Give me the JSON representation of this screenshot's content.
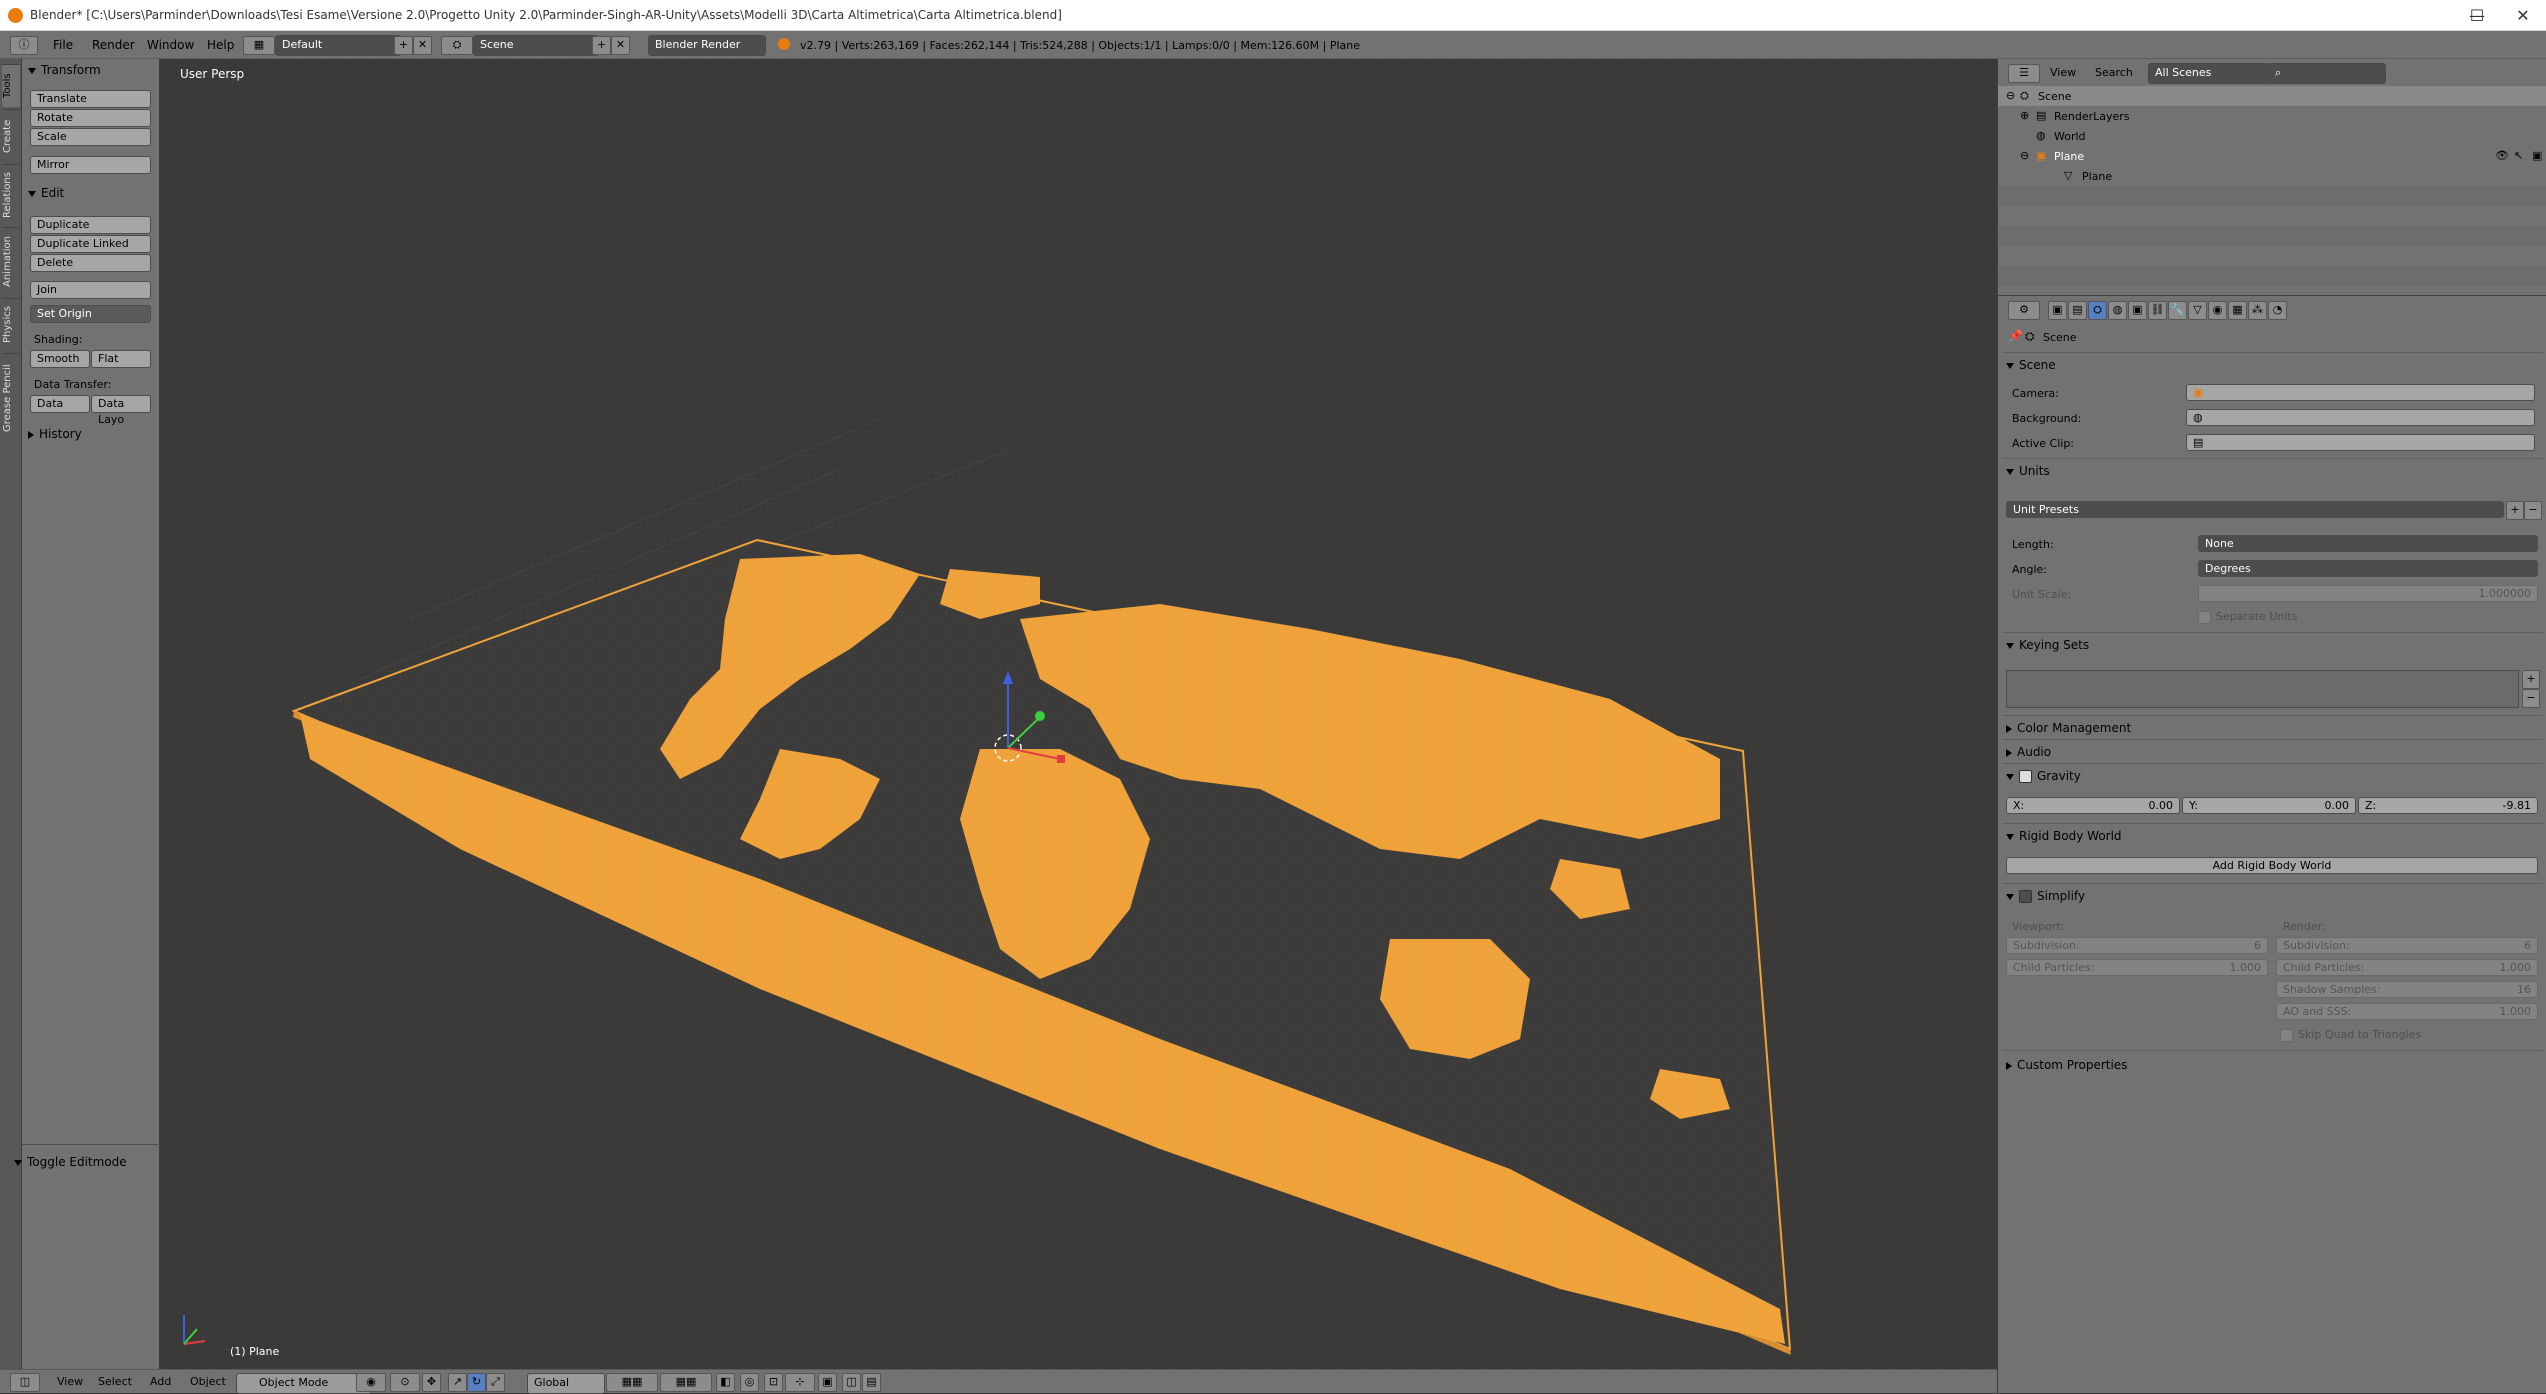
{
  "titlebar": {
    "title": "Blender* [C:\\Users\\Parminder\\Downloads\\Tesi Esame\\Versione 2.0\\Progetto Unity 2.0\\Parminder-Singh-AR-Unity\\Assets\\Modelli 3D\\Carta Altimetrica\\Carta Altimetrica.blend]",
    "minimize": "—",
    "maximize": "☐",
    "close": "✕"
  },
  "info_header": {
    "menus": [
      "File",
      "Render",
      "Window",
      "Help"
    ],
    "layout": "Default",
    "scene": "Scene",
    "engine": "Blender Render",
    "stats": "v2.79 | Verts:263,169 | Faces:262,144 | Tris:524,288 | Objects:1/1 | Lamps:0/0 | Mem:126.60M | Plane"
  },
  "tool_tabs": [
    "Tools",
    "Create",
    "Relations",
    "Animation",
    "Physics",
    "Grease Pencil"
  ],
  "tool_shelf": {
    "transform_title": "Transform",
    "translate": "Translate",
    "rotate": "Rotate",
    "scale": "Scale",
    "mirror": "Mirror",
    "edit_title": "Edit",
    "duplicate": "Duplicate",
    "duplicate_linked": "Duplicate Linked",
    "delete": "Delete",
    "join": "Join",
    "set_origin": "Set Origin",
    "shading_label": "Shading:",
    "smooth": "Smooth",
    "flat": "Flat",
    "data_transfer_label": "Data Transfer:",
    "data": "Data",
    "data_layout": "Data Layo",
    "history_title": "History",
    "toggle_editmode": "Toggle Editmode"
  },
  "viewport": {
    "view_label": "User Persp",
    "object_label": "(1) Plane",
    "mesh_color": "#f0a33b"
  },
  "bottom_header": {
    "menus": [
      "View",
      "Select",
      "Add",
      "Object"
    ],
    "mode": "Object Mode",
    "orientation": "Global"
  },
  "outliner": {
    "view": "View",
    "search": "Search",
    "scenes": "All Scenes",
    "items": [
      "Scene",
      "RenderLayers",
      "World",
      "Plane",
      "Plane"
    ]
  },
  "properties": {
    "context": "Scene",
    "scene_title": "Scene",
    "camera_label": "Camera:",
    "background_label": "Background:",
    "active_clip_label": "Active Clip:",
    "units_title": "Units",
    "unit_presets": "Unit Presets",
    "length_label": "Length:",
    "length_value": "None",
    "angle_label": "Angle:",
    "angle_value": "Degrees",
    "unit_scale_label": "Unit Scale:",
    "unit_scale_value": "1.000000",
    "separate_units": "Separate Units",
    "keying_sets_title": "Keying Sets",
    "color_management_title": "Color Management",
    "audio_title": "Audio",
    "gravity_title": "Gravity",
    "gravity_x_label": "X:",
    "gravity_x": "0.00",
    "gravity_y_label": "Y:",
    "gravity_y": "0.00",
    "gravity_z_label": "Z:",
    "gravity_z": "-9.81",
    "rigid_body_title": "Rigid Body World",
    "add_rigid_body": "Add Rigid Body World",
    "simplify_title": "Simplify",
    "viewport_label": "Viewport:",
    "render_label": "Render:",
    "subdivision_label": "Subdivision:",
    "subdivision_viewport": "6",
    "subdivision_render": "6",
    "child_particles_label": "Child Particles:",
    "child_particles_viewport": "1.000",
    "child_particles_render": "1.000",
    "shadow_samples_label": "Shadow Samples:",
    "shadow_samples": "16",
    "ao_sss_label": "AO and SSS:",
    "ao_sss": "1.000",
    "skip_quad": "Skip Quad to Triangles",
    "custom_props_title": "Custom Properties"
  }
}
